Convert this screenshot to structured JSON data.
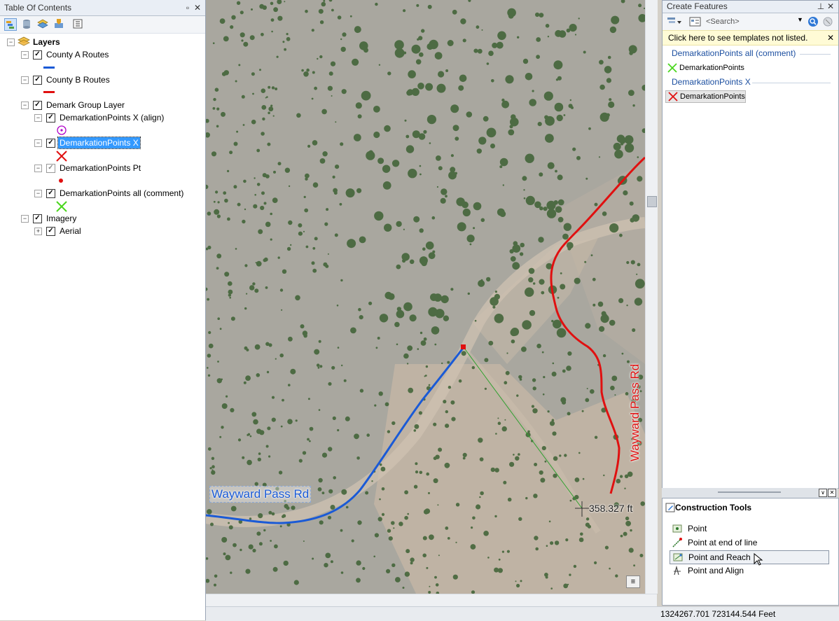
{
  "toc": {
    "title": "Table Of Contents",
    "buttons": [
      "pin",
      "close"
    ],
    "toolbar": [
      "list-by-drawing-order-icon",
      "list-by-source-icon",
      "list-by-visibility-icon",
      "list-by-selection-icon",
      "options-icon"
    ],
    "root_label": "Layers",
    "layers": {
      "county_a": "County A Routes",
      "county_b": "County B Routes",
      "demark_group": "Demark Group Layer",
      "dp_x_align": "DemarkationPoints X (align)",
      "dp_x": "DemarkationPoints X",
      "dp_pt": "DemarkationPoints Pt",
      "dp_all": "DemarkationPoints all (comment)",
      "imagery": "Imagery",
      "aerial": "Aerial"
    },
    "colors": {
      "county_a": "#1a5ad6",
      "county_b": "#e01010",
      "align": "#b000c8",
      "x": "#e01010",
      "pt": "#e01010",
      "all": "#4bd61e"
    }
  },
  "map": {
    "label_blue": "Wayward Pass Rd",
    "label_red": "Wayward Pass Rd",
    "measure": "358.327 ft",
    "colors": {
      "blue": "#1a5ad6",
      "red": "#e01010",
      "measure_line": "#2fa12f"
    }
  },
  "status": {
    "coords": "1324267.701  723144.544 Feet"
  },
  "create_features": {
    "title": "Create Features",
    "search_placeholder": "<Search>",
    "notice": "Click here to see templates not listed.",
    "groups": [
      {
        "name": "DemarkationPoints all (comment)",
        "template": "DemarkationPoints",
        "symbol": "green-x"
      },
      {
        "name": "DemarkationPoints X",
        "template": "DemarkationPoints",
        "symbol": "red-x"
      }
    ]
  },
  "construction_tools": {
    "title": "Construction Tools",
    "items": [
      "Point",
      "Point at end of line",
      "Point and Reach",
      "Point and Align"
    ]
  }
}
